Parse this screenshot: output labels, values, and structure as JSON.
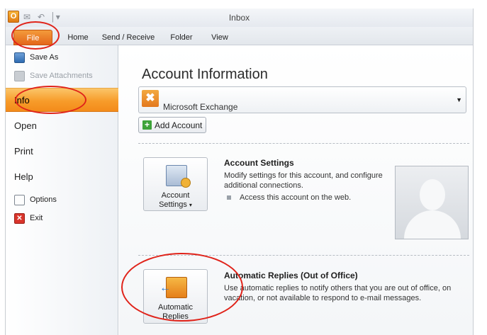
{
  "window": {
    "title": "Inbox"
  },
  "app_icon": {
    "letter": "O",
    "icon": "outlook-icon"
  },
  "quick_access": [
    {
      "icon": "send-receive-icon",
      "glyph": "✉"
    },
    {
      "icon": "undo-icon",
      "glyph": "↶"
    },
    {
      "icon": "customize-qat-icon",
      "glyph": "│▾"
    }
  ],
  "ribbon": {
    "tabs": [
      "File",
      "Home",
      "Send / Receive",
      "Folder",
      "View"
    ]
  },
  "nav": {
    "save_as": "Save As",
    "save_attachments": "Save Attachments",
    "info": "Info",
    "open": "Open",
    "print": "Print",
    "help": "Help",
    "options": "Options",
    "exit": "Exit",
    "exit_glyph": "✕"
  },
  "main": {
    "title": "Account Information",
    "account": {
      "name": "Microsoft Exchange",
      "icon_glyph": "✖",
      "arrow": "▼"
    },
    "add_account": {
      "plus": "+",
      "label": "Add Account"
    },
    "account_settings": {
      "button_line1": "Account",
      "button_line2": "Settings",
      "caret": "▾",
      "title": "Account Settings",
      "description": "Modify settings for this account, and configure additional connections.",
      "bullet": "Access this account on the web."
    },
    "auto_replies": {
      "button_line1": "Automatic",
      "button_line2": "Replies",
      "title": "Automatic Replies (Out of Office)",
      "description": "Use automatic replies to notify others that you are out of office, on vacation, or not available to respond to e-mail messages."
    }
  },
  "colors": {
    "accent_orange": "#f79c2a",
    "annotation_red": "#e0231a",
    "ribbon_bg": "#e3e7ec"
  }
}
